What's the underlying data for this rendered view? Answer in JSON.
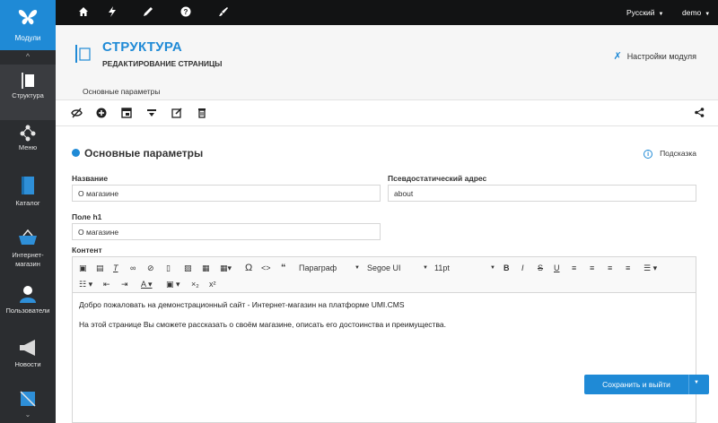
{
  "sidebar": {
    "logo_label": "Модули",
    "items": [
      {
        "label": "Структура"
      },
      {
        "label": "Меню"
      },
      {
        "label": "Каталог"
      },
      {
        "label1": "Интернет-",
        "label2": "магазин"
      },
      {
        "label": "Пользователи"
      },
      {
        "label": "Новости"
      }
    ]
  },
  "topbar": {
    "language": "Русский",
    "user": "demo"
  },
  "header": {
    "title": "СТРУКТУРА",
    "subtitle": "РЕДАКТИРОВАНИЕ СТРАНИЦЫ",
    "settings_label": "Настройки модуля"
  },
  "tabs": [
    {
      "label": "Основные параметры"
    }
  ],
  "section": {
    "title": "Основные параметры",
    "hint": "Подсказка"
  },
  "form": {
    "name_label": "Название",
    "name_value": "О магазине",
    "alias_label": "Псевдостатический адрес",
    "alias_value": "about",
    "h1_label": "Поле h1",
    "h1_value": "О магазине",
    "content_label": "Контент"
  },
  "editor": {
    "format": "Параграф",
    "font": "Segoe UI",
    "size": "11pt",
    "paragraph1": "Добро пожаловать на демонстрационный сайт - Интернет-магазин на платформе UMI.CMS",
    "paragraph2": "На этой странице Вы сможете рассказать о своём магазине, описать его достоинства и преимущества."
  },
  "actions": {
    "save_exit": "Сохранить и выйти"
  },
  "colors": {
    "accent": "#1f8ad6",
    "sidebar_bg": "#2b2d30",
    "topbar_bg": "#121314"
  }
}
